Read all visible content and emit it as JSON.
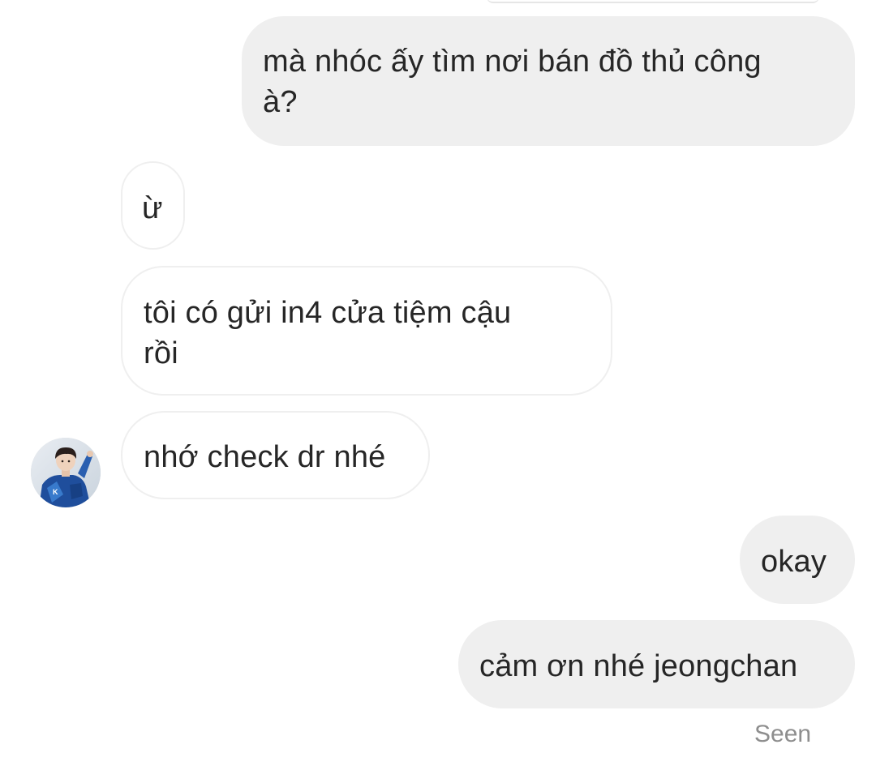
{
  "conversation": {
    "messages": [
      {
        "sender": "me",
        "lines": [
          "mà nhóc ấy tìm nơi bán đồ thủ công",
          "à?"
        ]
      },
      {
        "sender": "them",
        "lines": [
          "ừ"
        ]
      },
      {
        "sender": "them",
        "lines": [
          "tôi có gửi in4 cửa tiệm cậu",
          "rồi"
        ]
      },
      {
        "sender": "them",
        "lines": [
          "nhớ check dr nhé"
        ]
      },
      {
        "sender": "me",
        "lines": [
          "okay"
        ]
      },
      {
        "sender": "me",
        "lines": [
          "cảm ơn nhé jeongchan"
        ]
      }
    ],
    "read_receipt": "Seen"
  },
  "avatar": {
    "icon": "profile-photo",
    "jersey_letter": "K"
  },
  "colors": {
    "my_bubble": "#efefef",
    "their_bubble_border": "#efefef",
    "text": "#262626",
    "seen_text": "#8e8e8e"
  }
}
